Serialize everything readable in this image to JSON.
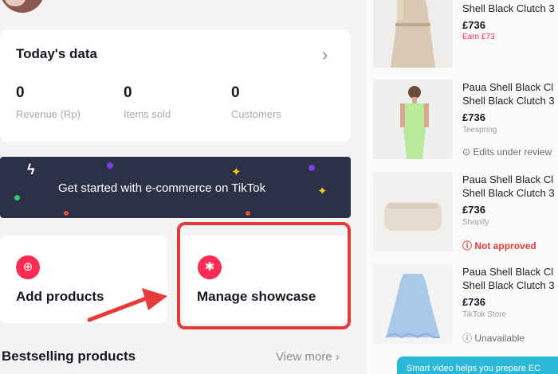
{
  "today": {
    "title": "Today's data",
    "metrics": [
      {
        "value": "0",
        "label": "Revenue (Rp)"
      },
      {
        "value": "0",
        "label": "Items sold"
      },
      {
        "value": "0",
        "label": "Customers"
      }
    ]
  },
  "banner": {
    "text": "Get started with e-commerce on TikTok"
  },
  "actions": {
    "add_products": "Add products",
    "manage_showcase": "Manage showcase"
  },
  "bestselling": {
    "title": "Bestselling products",
    "view_more": "View more"
  },
  "products": [
    {
      "title_lines": [
        "Shell Black Clutch 3"
      ],
      "price": "£736",
      "earn": "Earn £73"
    },
    {
      "title_lines": [
        "Paua Shell Black Cl",
        "Shell Black Clutch 3"
      ],
      "price": "£736",
      "source": "Teespring",
      "status": "Edits under review"
    },
    {
      "title_lines": [
        "Paua Shell Black Cl",
        "Shell Black Clutch 3"
      ],
      "price": "£736",
      "source": "Shopify",
      "status": "Not approved"
    },
    {
      "title_lines": [
        "Paua Shell Black Cl",
        "Shell Black Clutch 3"
      ],
      "price": "£736",
      "source": "TikTok Store",
      "status": "Unavailable"
    }
  ],
  "smart_video": {
    "text": "Smart video helps you prepare EC"
  },
  "colors": {
    "accent": "#fe2c55",
    "highlight": "#e63a3a",
    "banner_bg": "#2c3148",
    "smart_bg": "#2bb8d8"
  }
}
